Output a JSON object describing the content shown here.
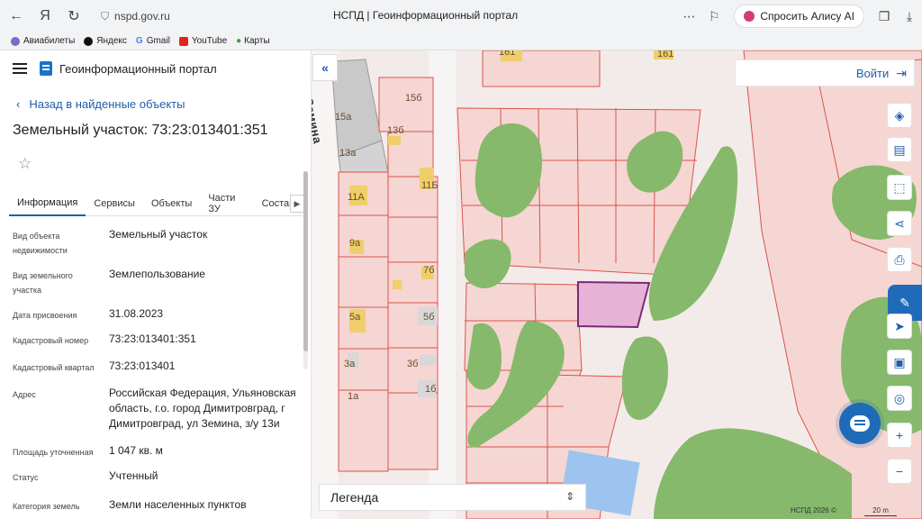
{
  "browser": {
    "url": "nspd.gov.ru",
    "tab_title": "НСПД | Геоинформационный портал",
    "alice_label": "Спросить Алису AI",
    "bookmarks": [
      "Авиабилеты",
      "Яндекс",
      "Gmail",
      "YouTube",
      "Карты"
    ]
  },
  "panel": {
    "portal_name": "Геоинформационный портал",
    "back_link": "Назад в найденные объекты",
    "object_title": "Земельный участок: 73:23:013401:351",
    "tabs": [
      "Информация",
      "Сервисы",
      "Объекты",
      "Части ЗУ",
      "Состав"
    ],
    "properties": [
      {
        "label": "Вид объекта недвижимости",
        "value": "Земельный участок"
      },
      {
        "label": "Вид земельного участка",
        "value": "Землепользование"
      },
      {
        "label": "Дата присвоения",
        "value": "31.08.2023"
      },
      {
        "label": "Кадастровый номер",
        "value": "73:23:013401:351"
      },
      {
        "label": "Кадастровый квартал",
        "value": "73:23:013401"
      },
      {
        "label": "Адрес",
        "value": "Российская Федерация, Ульяновская область, г.о. город Димитровград, г Димитровград, ул Земина, з/у 13и"
      },
      {
        "label": "Площадь уточненная",
        "value": "1 047 кв. м"
      },
      {
        "label": "Статус",
        "value": "Учтенный"
      },
      {
        "label": "Категория земель",
        "value": "Земли населенных пунктов"
      }
    ]
  },
  "map": {
    "login_label": "Войти",
    "legend_label": "Легенда",
    "copyright": "НСПД 2026 ©",
    "scale": "20 m",
    "street": "Земина",
    "house_labels": [
      "161",
      "161",
      "15б",
      "15а",
      "13б",
      "13а",
      "11А",
      "11Б",
      "9а",
      "7б",
      "5а",
      "5б",
      "3а",
      "3б",
      "1а",
      "1б"
    ],
    "colors": {
      "parcel_fill": "#f7d9d5",
      "parcel_border": "#d9534f",
      "selected_fill": "#e6b3d6",
      "selected_border": "#7b2a7a",
      "vegetation": "#86b96b",
      "road": "#f1efef",
      "accent": "#1f6bb8"
    }
  }
}
